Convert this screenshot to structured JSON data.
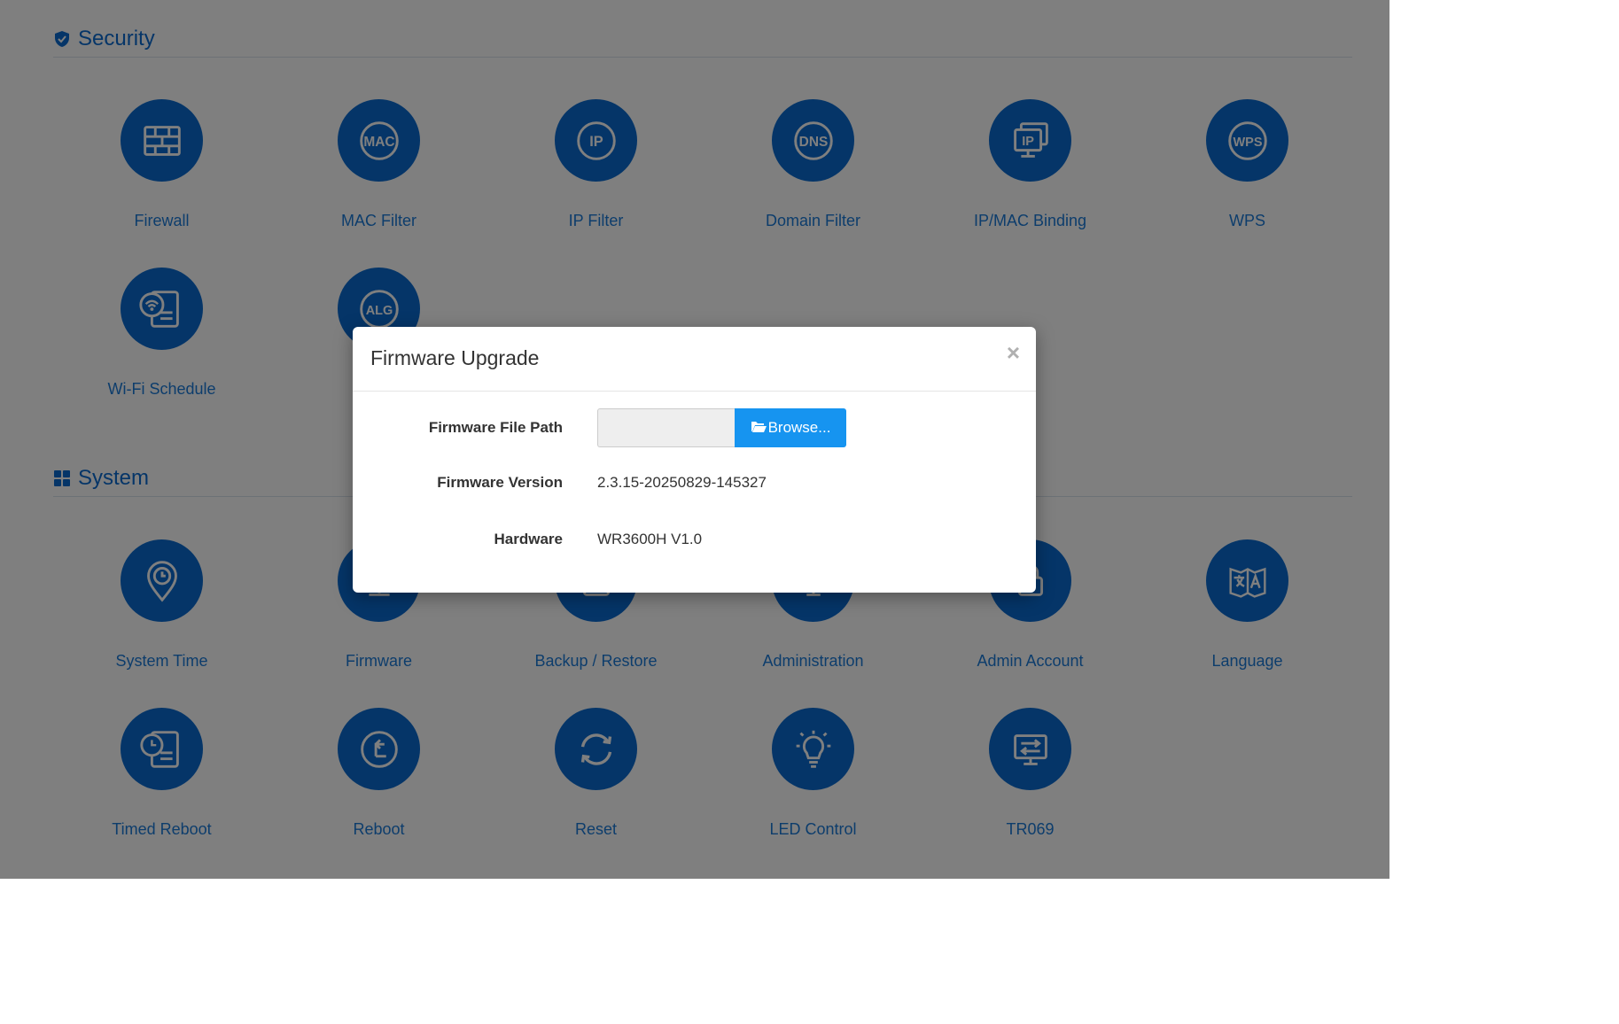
{
  "security": {
    "title": "Security",
    "icon": "shield-check-icon",
    "items": [
      {
        "label": "Firewall",
        "icon": "firewall-icon"
      },
      {
        "label": "MAC Filter",
        "icon": "mac-icon",
        "badge": "MAC"
      },
      {
        "label": "IP Filter",
        "icon": "ip-icon",
        "badge": "IP"
      },
      {
        "label": "Domain Filter",
        "icon": "dns-icon",
        "badge": "DNS"
      },
      {
        "label": "IP/MAC Binding",
        "icon": "ip-mac-binding-icon",
        "badge": "IP"
      },
      {
        "label": "WPS",
        "icon": "wps-icon",
        "badge": "WPS"
      },
      {
        "label": "Wi-Fi Schedule",
        "icon": "wifi-schedule-icon"
      },
      {
        "label": "",
        "icon": "alg-icon",
        "badge": "ALG"
      }
    ]
  },
  "system": {
    "title": "System",
    "icon": "grid-icon",
    "items": [
      {
        "label": "System Time",
        "icon": "system-time-icon"
      },
      {
        "label": "Firmware",
        "icon": "firmware-icon"
      },
      {
        "label": "Backup / Restore",
        "icon": "backup-restore-icon"
      },
      {
        "label": "Administration",
        "icon": "administration-icon"
      },
      {
        "label": "Admin Account",
        "icon": "admin-account-icon"
      },
      {
        "label": "Language",
        "icon": "language-icon"
      },
      {
        "label": "Timed Reboot",
        "icon": "timed-reboot-icon"
      },
      {
        "label": "Reboot",
        "icon": "reboot-icon"
      },
      {
        "label": "Reset",
        "icon": "reset-icon"
      },
      {
        "label": "LED Control",
        "icon": "led-control-icon"
      },
      {
        "label": "TR069",
        "icon": "tr069-icon"
      }
    ]
  },
  "modal": {
    "title": "Firmware Upgrade",
    "close": "×",
    "file_path_label": "Firmware File Path",
    "file_path_value": "",
    "browse_label": "Browse...",
    "version_label": "Firmware Version",
    "version_value": "2.3.15-20250829-145327",
    "hardware_label": "Hardware",
    "hardware_value": "WR3600H V1.0"
  },
  "colors": {
    "accent": "#0a6bd1",
    "label": "#1a7ad9",
    "button": "#1694f0",
    "overlay": "rgba(0,0,0,0.5)"
  }
}
